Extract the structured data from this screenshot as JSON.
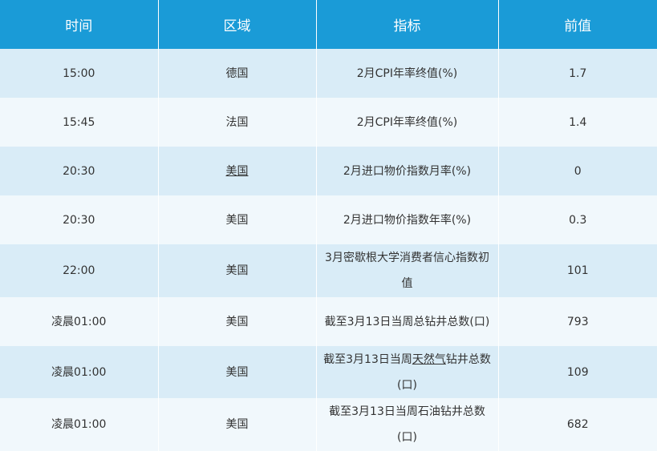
{
  "columns": [
    "时间",
    "区域",
    "指标",
    "前值"
  ],
  "rows": [
    {
      "time": "15:00",
      "region": "德国",
      "indicator": "2月CPI年率终值(%)",
      "prev": "1.7"
    },
    {
      "time": "15:45",
      "region": "法国",
      "indicator": "2月CPI年率终值(%)",
      "prev": "1.4"
    },
    {
      "time": "20:30",
      "region": "美国",
      "indicator": "2月进口物价指数月率(%)",
      "prev": "0"
    },
    {
      "time": "20:30",
      "region": "美国",
      "indicator": "2月进口物价指数年率(%)",
      "prev": "0.3"
    },
    {
      "time": "22:00",
      "region": "美国",
      "indicator": "3月密歇根大学消费者信心指数初值",
      "prev": "101"
    },
    {
      "time": "凌晨01:00",
      "region": "美国",
      "indicator": "截至3月13日当周总钻井总数(口)",
      "prev": "793"
    },
    {
      "time": "凌晨01:00",
      "region": "美国",
      "indicator_pre": "截至3月13日当周",
      "indicator_link": "天然气",
      "indicator_post": "钻井总数(口)",
      "prev": "109"
    },
    {
      "time": "凌晨01:00",
      "region": "美国",
      "indicator": "截至3月13日当周石油钻井总数(口)",
      "prev": "682"
    }
  ]
}
